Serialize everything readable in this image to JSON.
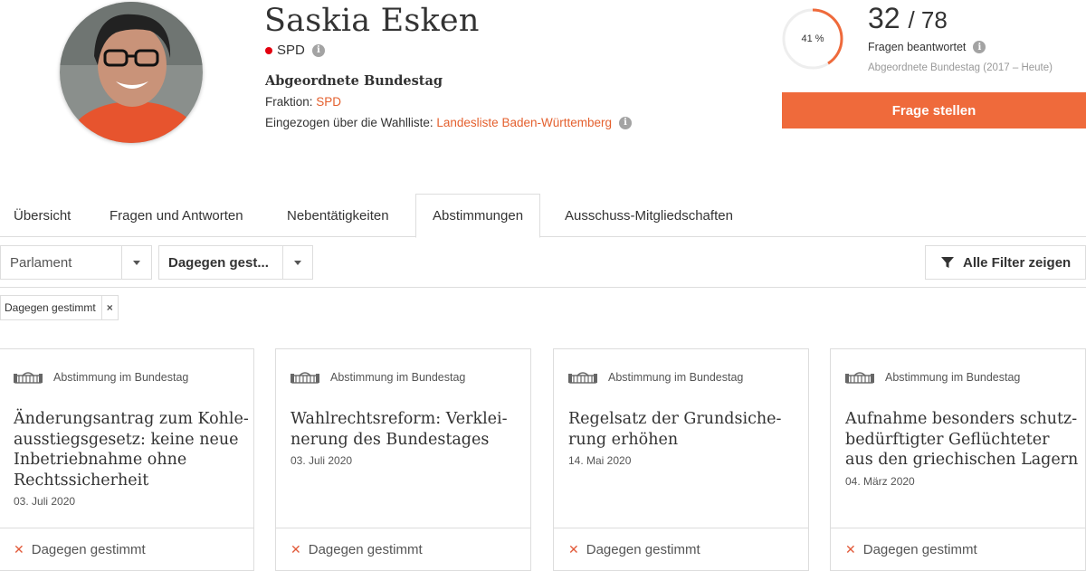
{
  "profile": {
    "name": "Saskia Esken",
    "party": "SPD",
    "role": "Abgeordnete Bundestag",
    "fraktion_label": "Fraktion:",
    "fraktion_value": "SPD",
    "wahlliste_label": "Eingezogen über die Wahlliste:",
    "wahlliste_value": "Landesliste Baden-Württemberg",
    "party_color": "#e3000f"
  },
  "stats": {
    "percent_label": "41 %",
    "percent_value": 0.41,
    "answered": "32",
    "slash_total": "/ 78",
    "answered_label": "Fragen beantwortet",
    "period": "Abgeordnete Bundestag (2017 – Heute)",
    "ask_button": "Frage stellen",
    "accent_color": "#ef6a3b"
  },
  "tabs": [
    {
      "label": "Übersicht",
      "active": false
    },
    {
      "label": "Fragen und Antworten",
      "active": false
    },
    {
      "label": "Nebentätigkeiten",
      "active": false
    },
    {
      "label": "Abstimmungen",
      "active": true
    },
    {
      "label": "Ausschuss-Mitgliedschaften",
      "active": false
    }
  ],
  "filters": {
    "parlament": "Parlament",
    "vote": "Dagegen gest...",
    "all_filters": "Alle Filter zeigen",
    "active_chip": "Dagegen gestimmt",
    "chip_close": "×"
  },
  "cards": [
    {
      "type": "Abstimmung im Bundestag",
      "title": "Änderungsantrag zum Kohle­ausstiegsgesetz: keine neue Inbetriebnahme ohne Rechtssicherheit",
      "date": "03. Juli 2020",
      "vote": "Dagegen gestimmt"
    },
    {
      "type": "Abstimmung im Bundestag",
      "title": "Wahlrechtsreform: Verklei­nerung des Bundestages",
      "date": "03. Juli 2020",
      "vote": "Dagegen gestimmt"
    },
    {
      "type": "Abstimmung im Bundestag",
      "title": "Regelsatz der Grundsiche­rung erhöhen",
      "date": "14. Mai 2020",
      "vote": "Dagegen gestimmt"
    },
    {
      "type": "Abstimmung im Bundestag",
      "title": "Aufnahme besonders schutz­bedürftigter Geflüchteter aus den griechischen Lagern",
      "date": "04. März 2020",
      "vote": "Dagegen gestimmt"
    }
  ]
}
